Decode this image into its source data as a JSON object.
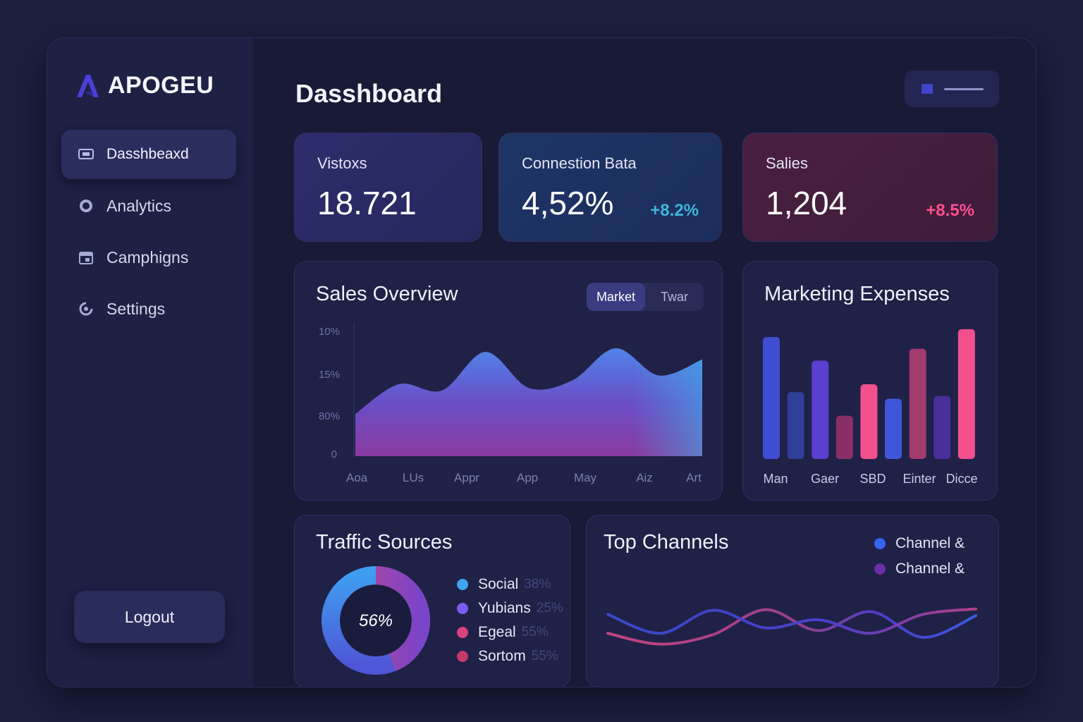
{
  "brand": {
    "name": "APOGEU"
  },
  "sidebar": {
    "items": [
      {
        "label": "Dasshbeaxd",
        "icon": "monitor-icon",
        "active": true
      },
      {
        "label": "Analytics",
        "icon": "chart-circle-icon",
        "active": false
      },
      {
        "label": "Camphigns",
        "icon": "calendar-icon",
        "active": false
      },
      {
        "label": "Settings",
        "icon": "settings-icon",
        "active": false
      }
    ],
    "logout_label": "Logout"
  },
  "header": {
    "title": "Dasshboard"
  },
  "stats": [
    {
      "label": "Vistoxs",
      "value": "18.721",
      "delta": ""
    },
    {
      "label": "Connestion Bata",
      "value": "4,52%",
      "delta": "+8.2%"
    },
    {
      "label": "Salies",
      "value": "1,204",
      "delta": "+8.5%"
    }
  ],
  "colors": {
    "accent_blue": "#3f44c9",
    "delta_teal": "#3fb6d9",
    "delta_pink": "#ff4f8e",
    "bar_blue": "#3f4dd1",
    "bar_pink": "#f2508d",
    "bar_purple": "#4a2e9a",
    "bar_maroon": "#a33a6e"
  },
  "sales_overview": {
    "title": "Sales Overview",
    "toggle": {
      "options": [
        "Market",
        "Twar"
      ],
      "selected": "Market"
    }
  },
  "marketing_expenses": {
    "title": "Marketing Expenses"
  },
  "traffic_sources": {
    "title": "Traffic Sources",
    "center_label": "56%",
    "items": [
      {
        "label": "Social",
        "pct": "38%",
        "color": "#3fa3f0"
      },
      {
        "label": "Yubians",
        "pct": "25%",
        "color": "#7a5cf0"
      },
      {
        "label": "Egeal",
        "pct": "55%",
        "color": "#d9437e"
      },
      {
        "label": "Sortom",
        "pct": "55%",
        "color": "#c43a6a"
      }
    ]
  },
  "top_channels": {
    "title": "Top Channels",
    "legend": [
      {
        "label": "Channel &",
        "color": "#3463f0"
      },
      {
        "label": "Channel &",
        "color": "#6a2fa8"
      }
    ]
  },
  "chart_data": [
    {
      "type": "area",
      "title": "Sales Overview",
      "categories": [
        "Aoa",
        "LUs",
        "Appr",
        "App",
        "May",
        "Aiz",
        "Art"
      ],
      "yticks": [
        "10%",
        "15%",
        "80%",
        "0"
      ],
      "values": [
        34,
        58,
        53,
        84,
        55,
        61,
        87,
        65,
        78
      ],
      "ylim": [
        0,
        100
      ]
    },
    {
      "type": "bar",
      "title": "Marketing Expenses",
      "categories": [
        "Man",
        "Gaer",
        "SBD",
        "Einter",
        "Dicce"
      ],
      "values": [
        93,
        51,
        75,
        33,
        57,
        46,
        84,
        48,
        99
      ],
      "colors": [
        "#3f4dd1",
        "#2f3f9a",
        "#5b3fd0",
        "#8a2f66",
        "#f2508d",
        "#3f56d8",
        "#a33a6e",
        "#4a2e9a",
        "#f2508d"
      ],
      "ylim": [
        0,
        100
      ]
    },
    {
      "type": "pie",
      "title": "Traffic Sources",
      "values": [
        56,
        44
      ],
      "labels": [
        "56%",
        ""
      ]
    },
    {
      "type": "line",
      "title": "Top Channels",
      "series": [
        {
          "name": "Channel &",
          "values": [
            30,
            14,
            28,
            65,
            34,
            62,
            24,
            56
          ]
        },
        {
          "name": "Channel &",
          "values": [
            58,
            30,
            64,
            38,
            50,
            30,
            58,
            66
          ]
        }
      ]
    }
  ]
}
